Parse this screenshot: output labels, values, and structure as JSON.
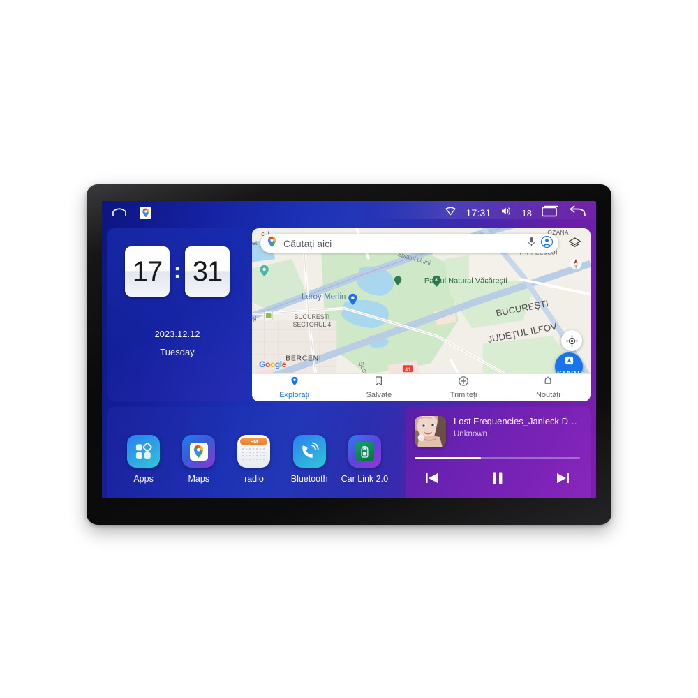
{
  "statusbar": {
    "home_icon": "home-icon",
    "maps_icon": "google-maps-icon",
    "wifi_icon": "wifi-icon",
    "time": "17:31",
    "volume_icon": "volume-icon",
    "volume_level": "18",
    "recents_icon": "recents-icon",
    "back_icon": "back-icon"
  },
  "clock_widget": {
    "hours": "17",
    "separator": ":",
    "minutes": "31",
    "date": "2023.12.12",
    "weekday": "Tuesday"
  },
  "maps_widget": {
    "search_placeholder": "Căutați aici",
    "search_icon": "google-maps-pin-icon",
    "mic_icon": "microphone-icon",
    "account_icon": "account-avatar-icon",
    "layers_icon": "map-layers-icon",
    "compass_icon": "compass-icon",
    "locate_icon": "my-location-icon",
    "start_button_label": "START",
    "start_button_icon": "navigation-arrow-icon",
    "attribution": "Google",
    "labels": [
      {
        "text": "Parcul Natural Văcărești",
        "type": "park"
      },
      {
        "text": "Leroy Merlin",
        "type": "poi"
      },
      {
        "text": "BUCUREȘTI SECTORUL 4",
        "type": "district"
      },
      {
        "text": "BUCUREȘTI",
        "type": "city"
      },
      {
        "text": "JUDEȚUL ILFOV",
        "type": "county"
      },
      {
        "text": "BERCENI",
        "type": "district"
      },
      {
        "text": "TRAPEZULUI",
        "type": "district"
      },
      {
        "text": "OZANA",
        "type": "district"
      },
      {
        "text": "Splaiul Unirii",
        "type": "road"
      },
      {
        "text": "Șoseaua Be",
        "type": "road"
      },
      {
        "text": "41",
        "type": "road-shield"
      }
    ],
    "nav": [
      {
        "label": "Explorați",
        "icon": "pin-icon",
        "active": true
      },
      {
        "label": "Salvate",
        "icon": "bookmark-icon",
        "active": false
      },
      {
        "label": "Trimiteți",
        "icon": "send-circle-icon",
        "active": false
      },
      {
        "label": "Noutăți",
        "icon": "bell-icon",
        "active": false
      }
    ]
  },
  "app_dock": {
    "apps": [
      {
        "label": "Apps",
        "icon": "apps-grid-icon"
      },
      {
        "label": "Maps",
        "icon": "google-maps-icon"
      },
      {
        "label": "radio",
        "icon": "fm-radio-icon"
      },
      {
        "label": "Bluetooth",
        "icon": "bluetooth-phone-icon"
      },
      {
        "label": "Car Link 2.0",
        "icon": "car-link-icon"
      }
    ]
  },
  "music_widget": {
    "title": "Lost Frequencies_Janieck Devy-...",
    "artist": "Unknown",
    "album_art": "album-art-portrait",
    "progress_percent": 40,
    "prev_icon": "previous-track-icon",
    "play_pause_icon": "pause-icon",
    "next_icon": "next-track-icon"
  },
  "colors": {
    "accent_blue": "#1a73e8",
    "wallpaper_start": "#0d1580",
    "wallpaper_end": "#7c1fab",
    "music_purple": "#6b22b2",
    "fm_orange": "#ef8235"
  }
}
